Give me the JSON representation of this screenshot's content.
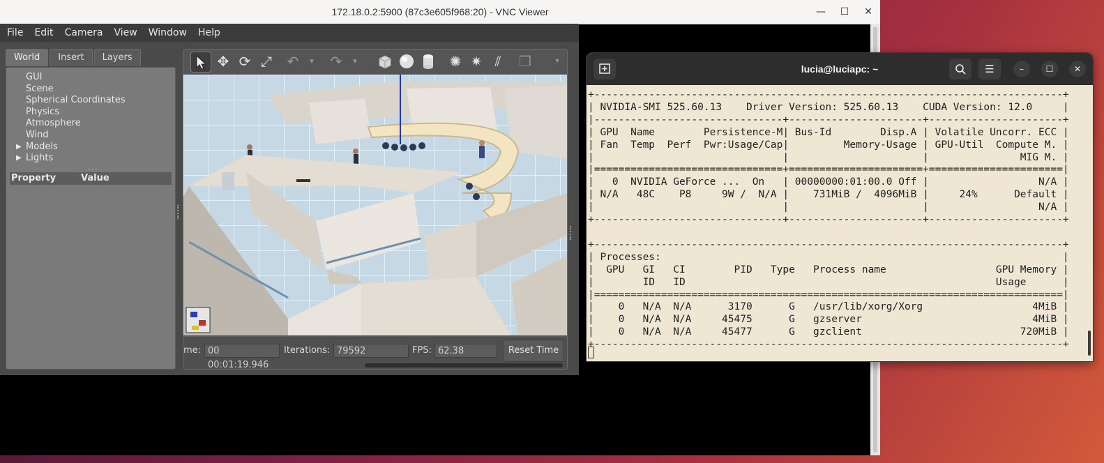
{
  "vnc": {
    "title": "172.18.0.2:5900 (87c3e605f968:20) - VNC Viewer",
    "controls": {
      "minimize": "—",
      "maximize": "☐",
      "close": "✕"
    }
  },
  "gazebo": {
    "menu": [
      "File",
      "Edit",
      "Camera",
      "View",
      "Window",
      "Help"
    ],
    "tabs": [
      "World",
      "Insert",
      "Layers"
    ],
    "tree": [
      "GUI",
      "Scene",
      "Spherical Coordinates",
      "Physics",
      "Atmosphere",
      "Wind",
      "Models",
      "Lights"
    ],
    "property_header": {
      "property": "Property",
      "value": "Value"
    },
    "toolbar_icons": [
      "select-icon",
      "translate-icon",
      "rotate-icon",
      "scale-icon",
      "undo-icon",
      "redo-icon",
      "box-icon",
      "sphere-icon",
      "cylinder-icon",
      "point-light-icon",
      "spot-light-icon",
      "directional-light-icon",
      "copy-icon"
    ],
    "status": {
      "time_label": "me:",
      "time_value": "00 00:01:19.946",
      "iterations_label": "Iterations:",
      "iterations_value": "79592",
      "fps_label": "FPS:",
      "fps_value": "62.38",
      "reset_button": "Reset Time"
    }
  },
  "terminal": {
    "title": "lucia@luciapc: ~",
    "new_tab_icon": "new-tab-icon",
    "output": "+-----------------------------------------------------------------------------+\n| NVIDIA-SMI 525.60.13    Driver Version: 525.60.13    CUDA Version: 12.0     |\n|-------------------------------+----------------------+----------------------+\n| GPU  Name        Persistence-M| Bus-Id        Disp.A | Volatile Uncorr. ECC |\n| Fan  Temp  Perf  Pwr:Usage/Cap|         Memory-Usage | GPU-Util  Compute M. |\n|                               |                      |               MIG M. |\n|===============================+======================+======================|\n|   0  NVIDIA GeForce ...  On   | 00000000:01:00.0 Off |                  N/A |\n| N/A   48C    P8     9W /  N/A |    731MiB /  4096MiB |     24%      Default |\n|                               |                      |                  N/A |\n+-------------------------------+----------------------+----------------------+\n\n+-----------------------------------------------------------------------------+\n| Processes:                                                                  |\n|  GPU   GI   CI        PID   Type   Process name                  GPU Memory |\n|        ID   ID                                                   Usage      |\n|=============================================================================|\n|    0   N/A  N/A      3170      G   /usr/lib/xorg/Xorg                  4MiB |\n|    0   N/A  N/A     45475      G   gzserver                            4MiB |\n|    0   N/A  N/A     45477      G   gzclient                          720MiB |\n+-----------------------------------------------------------------------------+"
  }
}
